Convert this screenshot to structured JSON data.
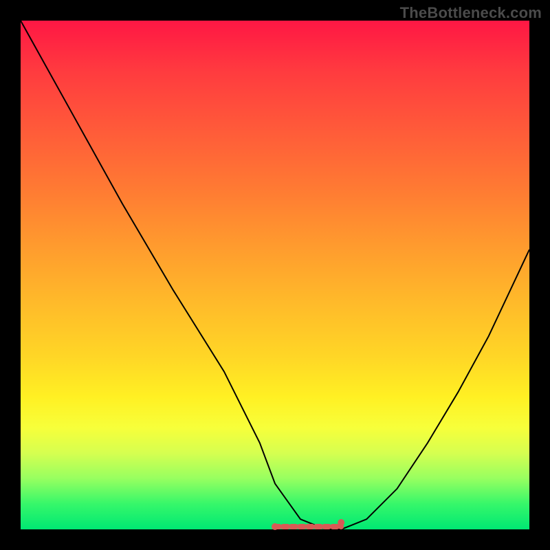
{
  "watermark": "TheBottleneck.com",
  "chart_data": {
    "type": "line",
    "title": "",
    "xlabel": "",
    "ylabel": "",
    "xlim": [
      0,
      100
    ],
    "ylim": [
      0,
      100
    ],
    "grid": false,
    "legend": false,
    "series": [
      {
        "name": "curve",
        "x": [
          0,
          10,
          20,
          30,
          40,
          47,
          50,
          55,
          60,
          63,
          68,
          74,
          80,
          86,
          92,
          100
        ],
        "values": [
          100,
          82,
          64,
          47,
          31,
          17,
          9,
          2,
          0,
          0,
          2,
          8,
          17,
          27,
          38,
          55
        ]
      }
    ],
    "optimal_band": {
      "x_start": 50,
      "x_end": 63,
      "y": 0
    },
    "background_gradient": {
      "top": "#ff1744",
      "mid1": "#ff9a2e",
      "mid2": "#fff023",
      "bottom": "#00e873"
    }
  }
}
